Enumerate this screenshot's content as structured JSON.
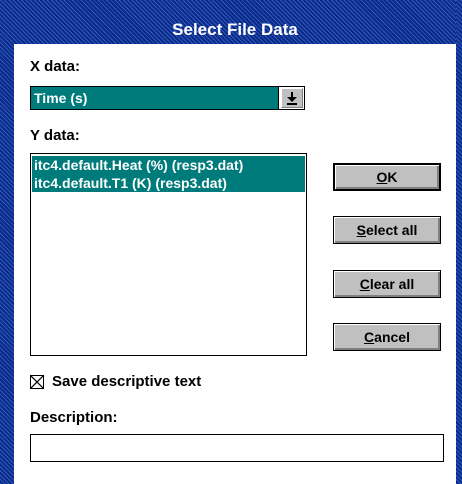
{
  "window": {
    "title": "Select File Data"
  },
  "x_data": {
    "label": "X data:",
    "selected": "Time (s)",
    "dropdown_icon": "arrow-down-underline-icon"
  },
  "y_data": {
    "label": "Y data:",
    "items": [
      {
        "text": "itc4.default.Heat (%) (resp3.dat)",
        "selected": true
      },
      {
        "text": "itc4.default.T1 (K) (resp3.dat)",
        "selected": true
      }
    ]
  },
  "buttons": {
    "ok": {
      "mnemonic": "O",
      "rest": "K"
    },
    "select_all": {
      "mnemonic": "S",
      "rest": "elect all"
    },
    "clear_all": {
      "mnemonic": "C",
      "rest": "lear all"
    },
    "cancel": {
      "mnemonic": "C",
      "rest": "ancel"
    }
  },
  "save_text": {
    "label": "Save descriptive text",
    "checked": true
  },
  "description": {
    "label": "Description:",
    "value": ""
  },
  "colors": {
    "selection": "#007b7b",
    "title_bar": "#0a2a86",
    "button_face": "#c0c0c0"
  }
}
